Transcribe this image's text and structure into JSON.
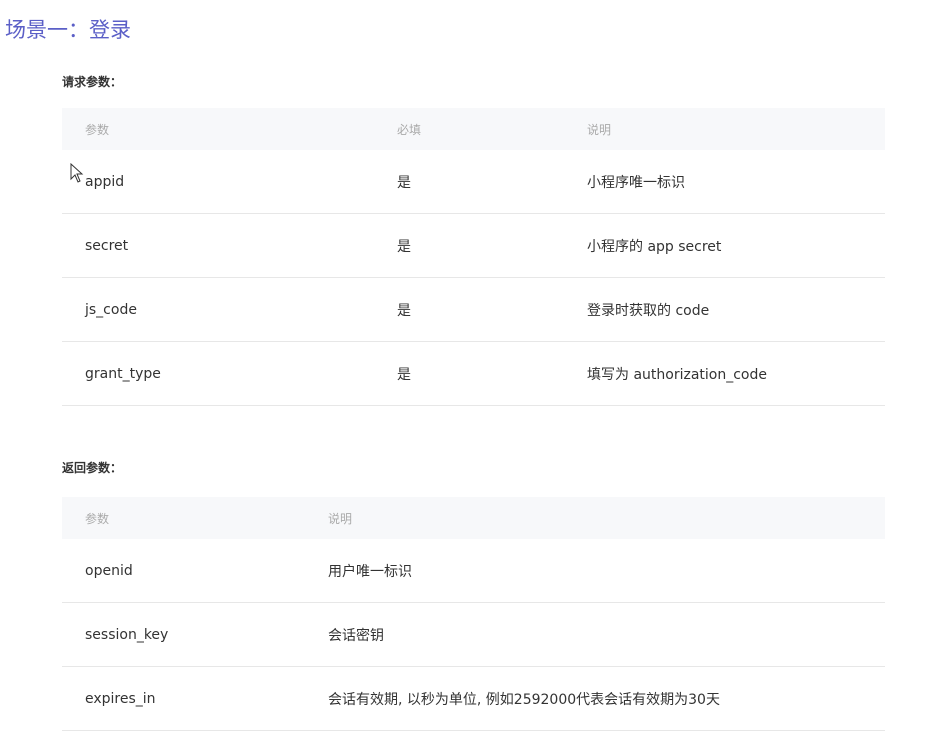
{
  "title": "场景一：登录",
  "request": {
    "label": "请求参数：",
    "headers": [
      "参数",
      "必填",
      "说明"
    ],
    "rows": [
      [
        "appid",
        "是",
        "小程序唯一标识"
      ],
      [
        "secret",
        "是",
        "小程序的 app secret"
      ],
      [
        "js_code",
        "是",
        "登录时获取的 code"
      ],
      [
        "grant_type",
        "是",
        "填写为 authorization_code"
      ]
    ]
  },
  "response": {
    "label": "返回参数：",
    "headers": [
      "参数",
      "说明"
    ],
    "rows": [
      [
        "openid",
        "用户唯一标识"
      ],
      [
        "session_key",
        "会话密钥"
      ],
      [
        "expires_in",
        "会话有效期, 以秒为单位, 例如2592000代表会话有效期为30天"
      ]
    ]
  }
}
